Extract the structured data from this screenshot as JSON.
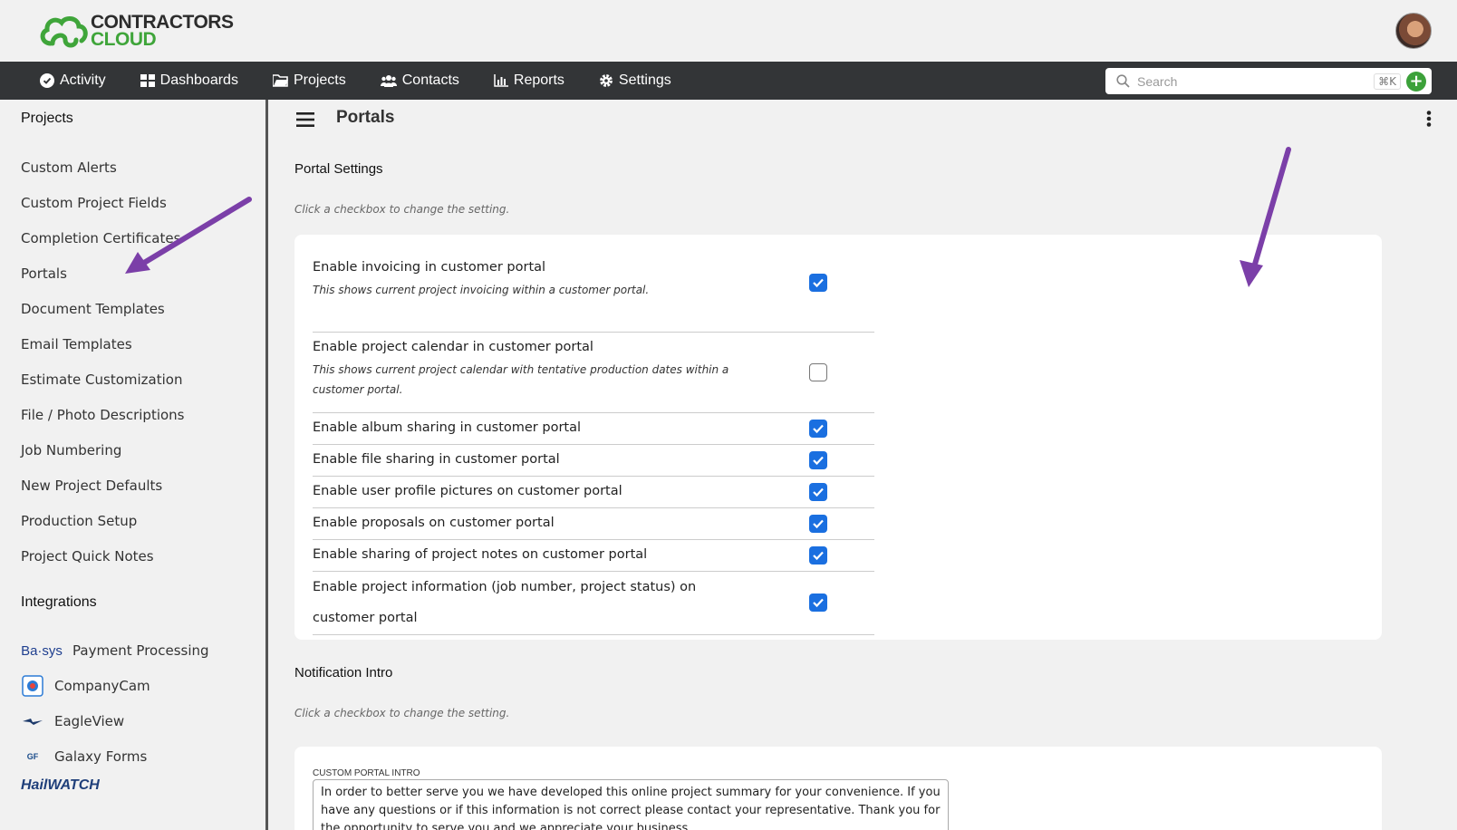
{
  "app": {
    "brand_line1": "CONTRACTORS",
    "brand_line2": "CLOUD",
    "brand_color": "#3fa53a"
  },
  "nav": {
    "items": [
      {
        "label": "Activity",
        "icon": "check-circle-icon"
      },
      {
        "label": "Dashboards",
        "icon": "grid-icon"
      },
      {
        "label": "Projects",
        "icon": "folder-icon"
      },
      {
        "label": "Contacts",
        "icon": "users-icon"
      },
      {
        "label": "Reports",
        "icon": "bar-chart-icon"
      },
      {
        "label": "Settings",
        "icon": "gear-icon"
      }
    ],
    "search_placeholder": "Search",
    "search_shortcut": "⌘K",
    "add_label": "+"
  },
  "sidebar": {
    "projects_heading": "Projects",
    "items": [
      "Custom Alerts",
      "Custom Project Fields",
      "Completion Certificates",
      "Portals",
      "Document Templates",
      "Email Templates",
      "Estimate Customization",
      "File / Photo Descriptions",
      "Job Numbering",
      "New Project Defaults",
      "Production Setup",
      "Project Quick Notes"
    ],
    "integrations_heading": "Integrations",
    "integrations": [
      {
        "label": "Payment Processing",
        "logo": "Ba·sys"
      },
      {
        "label": "CompanyCam",
        "logo": "companycam-icon"
      },
      {
        "label": "EagleView",
        "logo": "eagleview-icon"
      },
      {
        "label": "Galaxy Forms",
        "logo": "GF"
      }
    ],
    "hailwatch_logo": "HailWATCH"
  },
  "main": {
    "title": "Portals",
    "portal_settings": {
      "title": "Portal Settings",
      "hint": "Click a checkbox to change the setting.",
      "rows": [
        {
          "label": "Enable invoicing in customer portal",
          "desc": "This shows current project invoicing within a customer portal.",
          "checked": true
        },
        {
          "label": "Enable project calendar in customer portal",
          "desc": "This shows current project calendar with tentative production dates within a customer portal.",
          "checked": false
        },
        {
          "label": "Enable album sharing in customer portal",
          "checked": true
        },
        {
          "label": "Enable file sharing in customer portal",
          "checked": true
        },
        {
          "label": "Enable user profile pictures on customer portal",
          "checked": true
        },
        {
          "label": "Enable proposals on customer portal",
          "checked": true
        },
        {
          "label": "Enable sharing of project notes on customer portal",
          "checked": true
        },
        {
          "label": "Enable project information (job number, project status) on customer portal",
          "checked": true
        }
      ]
    },
    "notification_intro": {
      "title": "Notification Intro",
      "hint": "Click a checkbox to change the setting.",
      "field_label": "CUSTOM PORTAL INTRO",
      "value": "In order to better serve you we have developed this online project summary for your convenience. If you have any questions or if this information is not correct please contact your representative. Thank you for the opportunity to serve you and we appreciate your business."
    }
  },
  "colors": {
    "navbar": "#333537",
    "checkbox_on": "#1a6fe0",
    "annotation_arrow": "#7b3fa8"
  }
}
